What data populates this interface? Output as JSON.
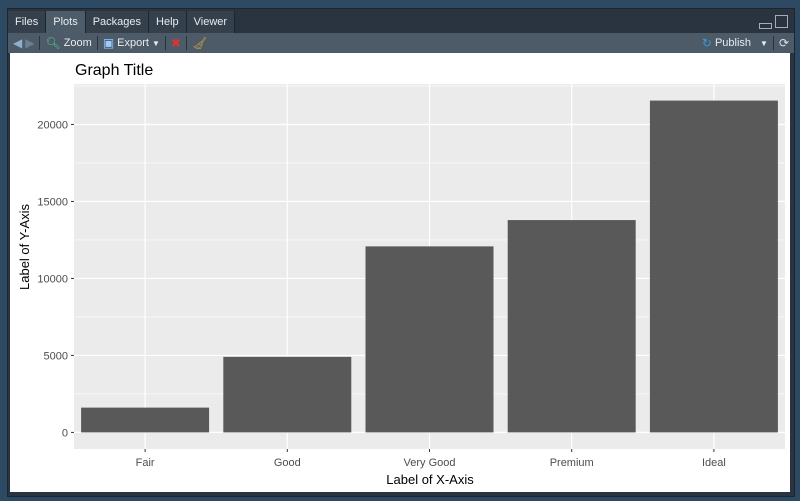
{
  "tabs": [
    "Files",
    "Plots",
    "Packages",
    "Help",
    "Viewer"
  ],
  "active_tab": "Plots",
  "toolbar": {
    "zoom": "Zoom",
    "export": "Export",
    "publish": "Publish"
  },
  "chart_data": {
    "type": "bar",
    "title": "Graph Title",
    "xlabel": "Label of X-Axis",
    "ylabel": "Label of Y-Axis",
    "categories": [
      "Fair",
      "Good",
      "Very Good",
      "Premium",
      "Ideal"
    ],
    "values": [
      1610,
      4906,
      12082,
      13791,
      21551
    ],
    "ylim": [
      -1078,
      22628
    ],
    "yticks": [
      0,
      5000,
      10000,
      15000,
      20000
    ],
    "grid": true,
    "bar_color": "#595959",
    "panel_color": "#ebebeb"
  }
}
